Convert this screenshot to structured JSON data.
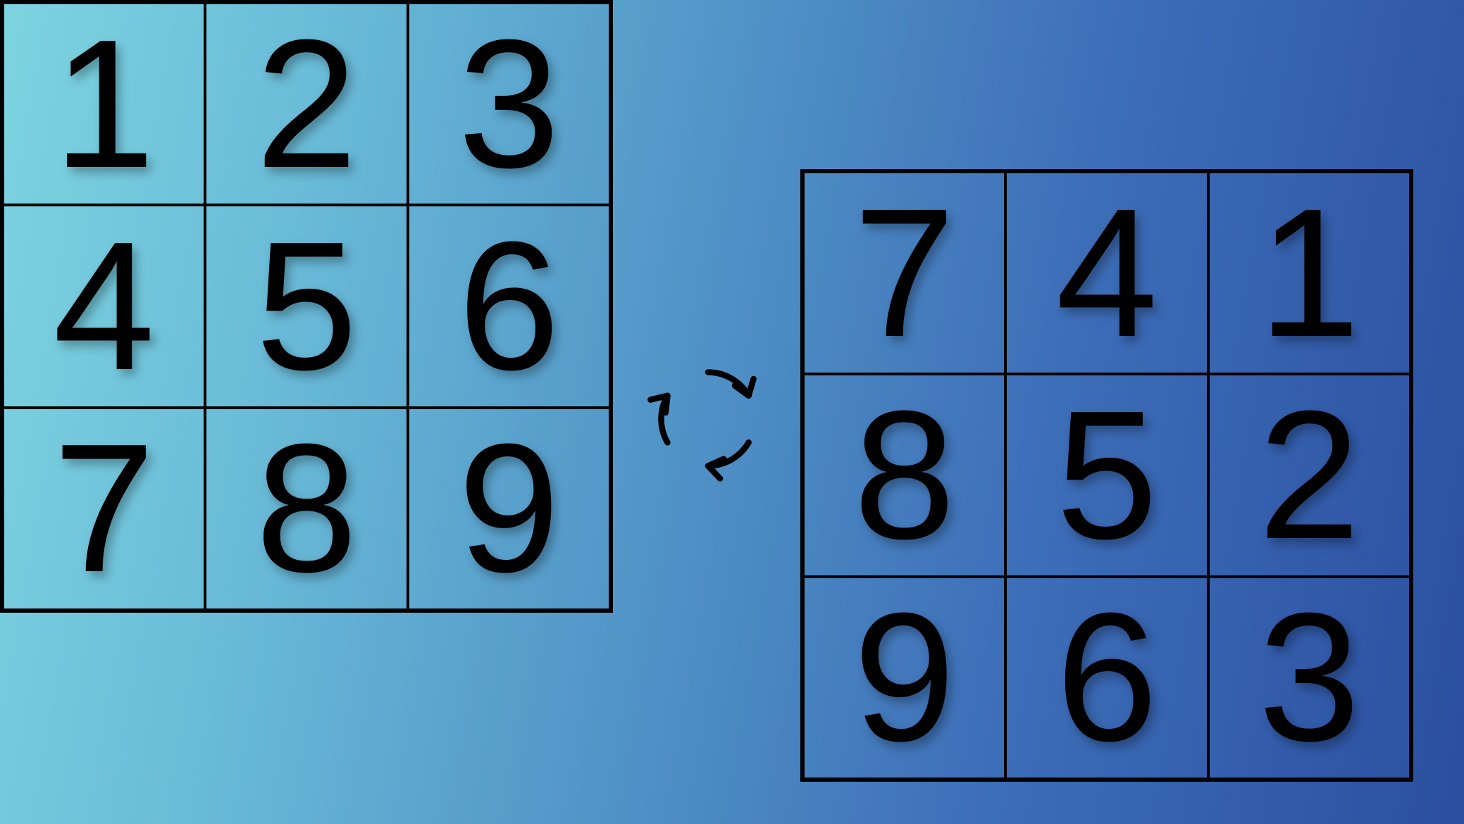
{
  "gridLeft": {
    "cells": [
      "1",
      "2",
      "3",
      "4",
      "5",
      "6",
      "7",
      "8",
      "9"
    ]
  },
  "gridRight": {
    "cells": [
      "7",
      "4",
      "1",
      "8",
      "5",
      "2",
      "9",
      "6",
      "3"
    ]
  },
  "icon": "rotate"
}
